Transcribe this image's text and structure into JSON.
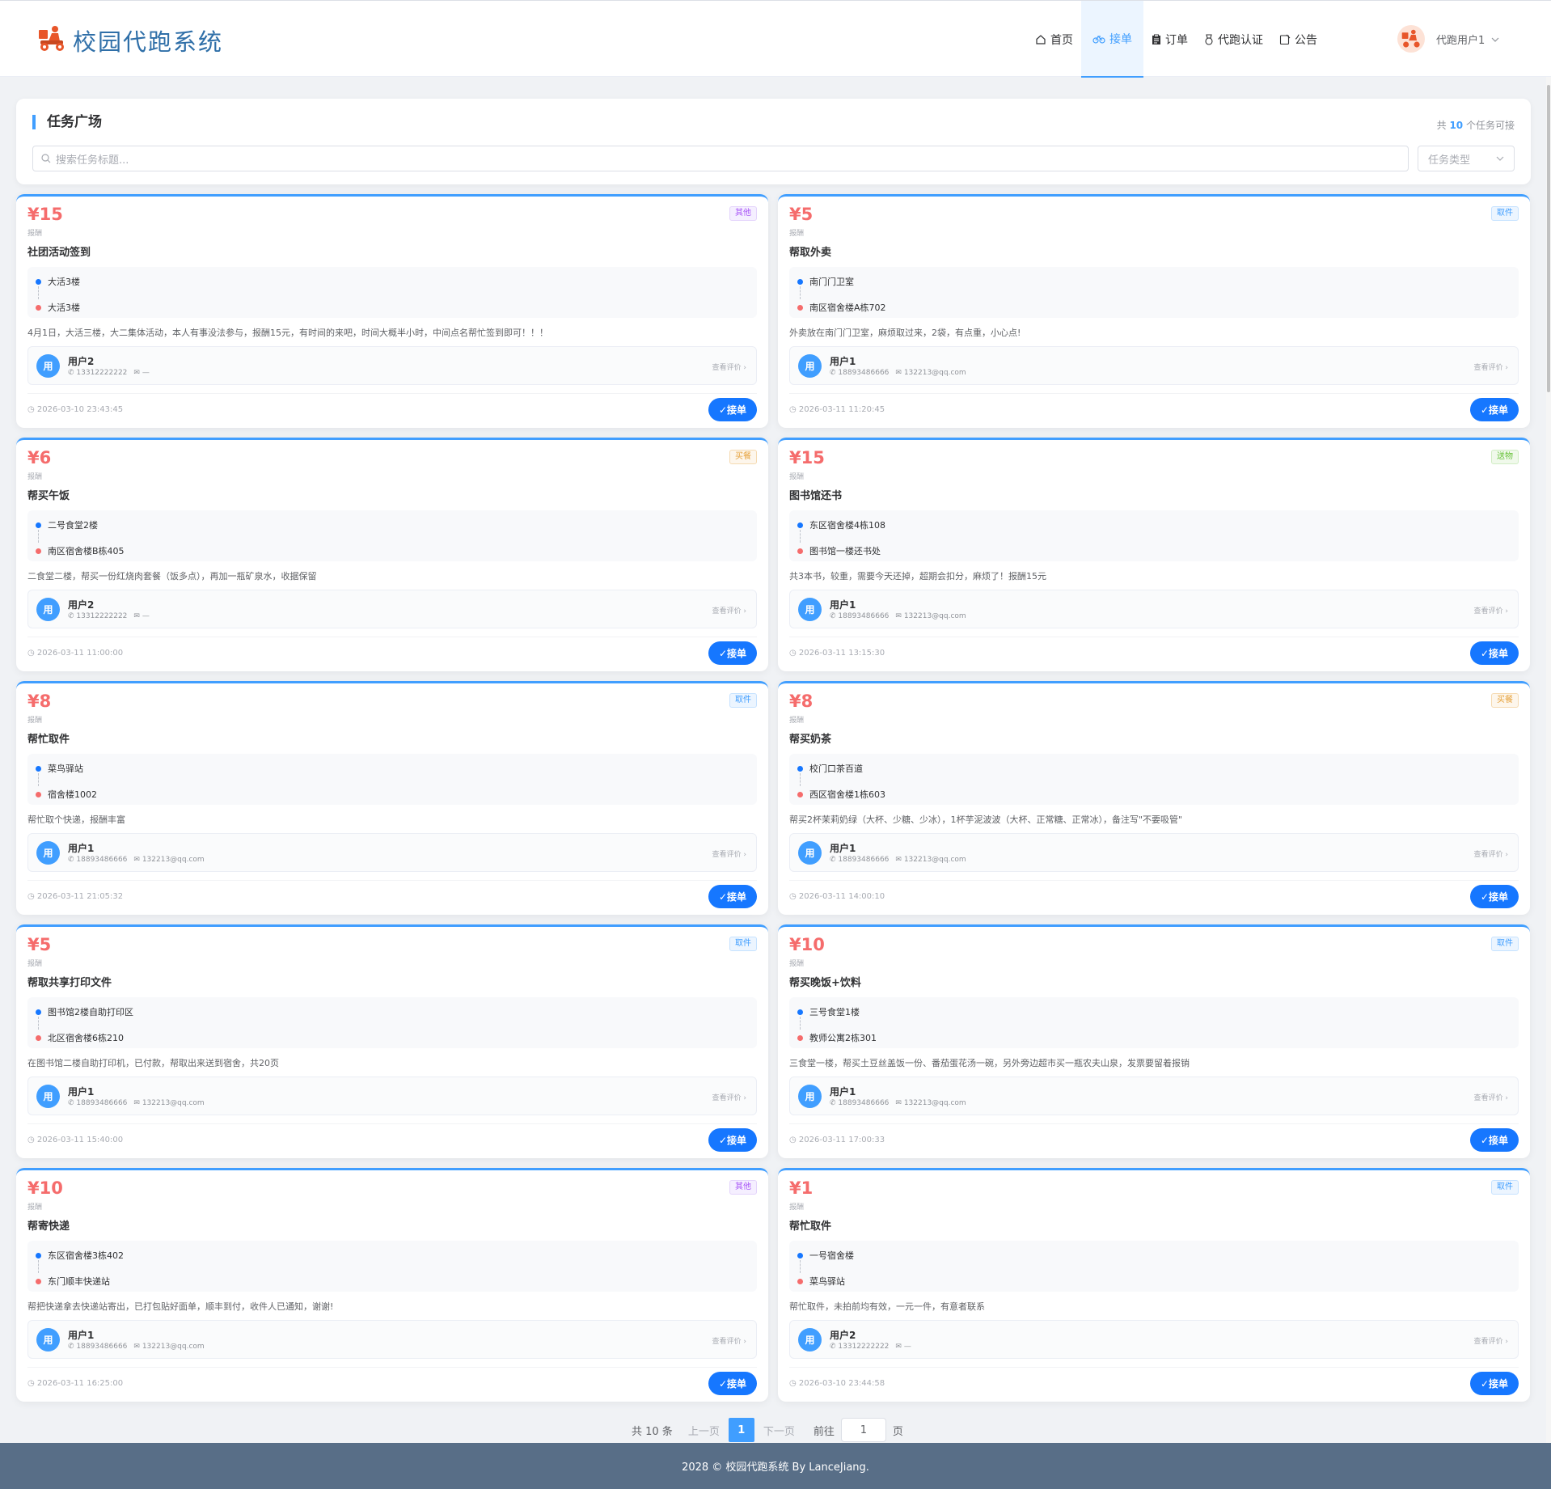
{
  "app": {
    "title": "校园代跑系统"
  },
  "nav": [
    {
      "label": "首页",
      "icon": "home-icon"
    },
    {
      "label": "接单",
      "icon": "bicycle-icon"
    },
    {
      "label": "订单",
      "icon": "clipboard-icon"
    },
    {
      "label": "代跑认证",
      "icon": "medal-icon"
    },
    {
      "label": "公告",
      "icon": "notice-icon"
    }
  ],
  "user": {
    "name": "代跑用户1"
  },
  "panel": {
    "title": "任务广场",
    "count_prefix": "共",
    "count": "10",
    "count_suffix": "个任务可接",
    "search_placeholder": "搜索任务标题...",
    "type_placeholder": "任务类型"
  },
  "card_labels": {
    "price_label": "报酬",
    "review": "查看评价 ›",
    "accept": "✓接单",
    "avatar": "用"
  },
  "tasks": [
    {
      "price": "¥15",
      "tag": "其他",
      "tag_type": "other",
      "title": "社团活动签到",
      "from": "大活3楼",
      "to": "大活3楼",
      "desc": "4月1日，大活三楼，大二集体活动，本人有事没法参与，报酬15元，有时间的来吧，时间大概半小时，中间点名帮忙签到即可！！！",
      "user": "用户2",
      "phone": "13312222222",
      "email": "—",
      "time": "2026-03-10 23:43:45"
    },
    {
      "price": "¥5",
      "tag": "取件",
      "tag_type": "take",
      "title": "帮取外卖",
      "from": "南门门卫室",
      "to": "南区宿舍楼A栋702",
      "desc": "外卖放在南门门卫室，麻烦取过来，2袋，有点重，小心点!",
      "user": "用户1",
      "phone": "18893486666",
      "email": "132213@qq.com",
      "time": "2026-03-11 11:20:45"
    },
    {
      "price": "¥6",
      "tag": "买餐",
      "tag_type": "buy",
      "title": "帮买午饭",
      "from": "二号食堂2楼",
      "to": "南区宿舍楼B栋405",
      "desc": "二食堂二楼，帮买一份红烧肉套餐（饭多点），再加一瓶矿泉水，收据保留",
      "user": "用户2",
      "phone": "13312222222",
      "email": "—",
      "time": "2026-03-11 11:00:00"
    },
    {
      "price": "¥15",
      "tag": "送物",
      "tag_type": "send",
      "title": "图书馆还书",
      "from": "东区宿舍楼4栋108",
      "to": "图书馆一楼还书处",
      "desc": "共3本书，较重，需要今天还掉，超期会扣分，麻烦了！报酬15元",
      "user": "用户1",
      "phone": "18893486666",
      "email": "132213@qq.com",
      "time": "2026-03-11 13:15:30"
    },
    {
      "price": "¥8",
      "tag": "取件",
      "tag_type": "take",
      "title": "帮忙取件",
      "from": "菜鸟驿站",
      "to": "宿舍楼1002",
      "desc": "帮忙取个快递，报酬丰富",
      "user": "用户1",
      "phone": "18893486666",
      "email": "132213@qq.com",
      "time": "2026-03-11 21:05:32"
    },
    {
      "price": "¥8",
      "tag": "买餐",
      "tag_type": "buy",
      "title": "帮买奶茶",
      "from": "校门口茶百道",
      "to": "西区宿舍楼1栋603",
      "desc": "帮买2杯茉莉奶绿（大杯、少糖、少冰），1杯芋泥波波（大杯、正常糖、正常冰），备注写\"不要吸管\"",
      "user": "用户1",
      "phone": "18893486666",
      "email": "132213@qq.com",
      "time": "2026-03-11 14:00:10"
    },
    {
      "price": "¥5",
      "tag": "取件",
      "tag_type": "take",
      "title": "帮取共享打印文件",
      "from": "图书馆2楼自助打印区",
      "to": "北区宿舍楼6栋210",
      "desc": "在图书馆二楼自助打印机，已付款，帮取出来送到宿舍，共20页",
      "user": "用户1",
      "phone": "18893486666",
      "email": "132213@qq.com",
      "time": "2026-03-11 15:40:00"
    },
    {
      "price": "¥10",
      "tag": "取件",
      "tag_type": "take",
      "title": "帮买晚饭+饮料",
      "from": "三号食堂1楼",
      "to": "教师公寓2栋301",
      "desc": "三食堂一楼，帮买土豆丝盖饭一份、番茄蛋花汤一碗，另外旁边超市买一瓶农夫山泉，发票要留着报销",
      "user": "用户1",
      "phone": "18893486666",
      "email": "132213@qq.com",
      "time": "2026-03-11 17:00:33"
    },
    {
      "price": "¥10",
      "tag": "其他",
      "tag_type": "other",
      "title": "帮寄快递",
      "from": "东区宿舍楼3栋402",
      "to": "东门顺丰快递站",
      "desc": "帮把快递拿去快递站寄出，已打包贴好面单，顺丰到付，收件人已通知，谢谢!",
      "user": "用户1",
      "phone": "18893486666",
      "email": "132213@qq.com",
      "time": "2026-03-11 16:25:00"
    },
    {
      "price": "¥1",
      "tag": "取件",
      "tag_type": "take",
      "title": "帮忙取件",
      "from": "一号宿舍楼",
      "to": "菜鸟驿站",
      "desc": "帮忙取件，未拍前均有效，一元一件，有意者联系",
      "user": "用户2",
      "phone": "13312222222",
      "email": "—",
      "time": "2026-03-10 23:44:58"
    }
  ],
  "pagination": {
    "total": "共 10 条",
    "prev": "上一页",
    "current": "1",
    "next": "下一页",
    "goto": "前往",
    "goto_value": "1",
    "page_unit": "页"
  },
  "footer": {
    "text": "2028 © 校园代跑系统 By LanceJiang."
  }
}
